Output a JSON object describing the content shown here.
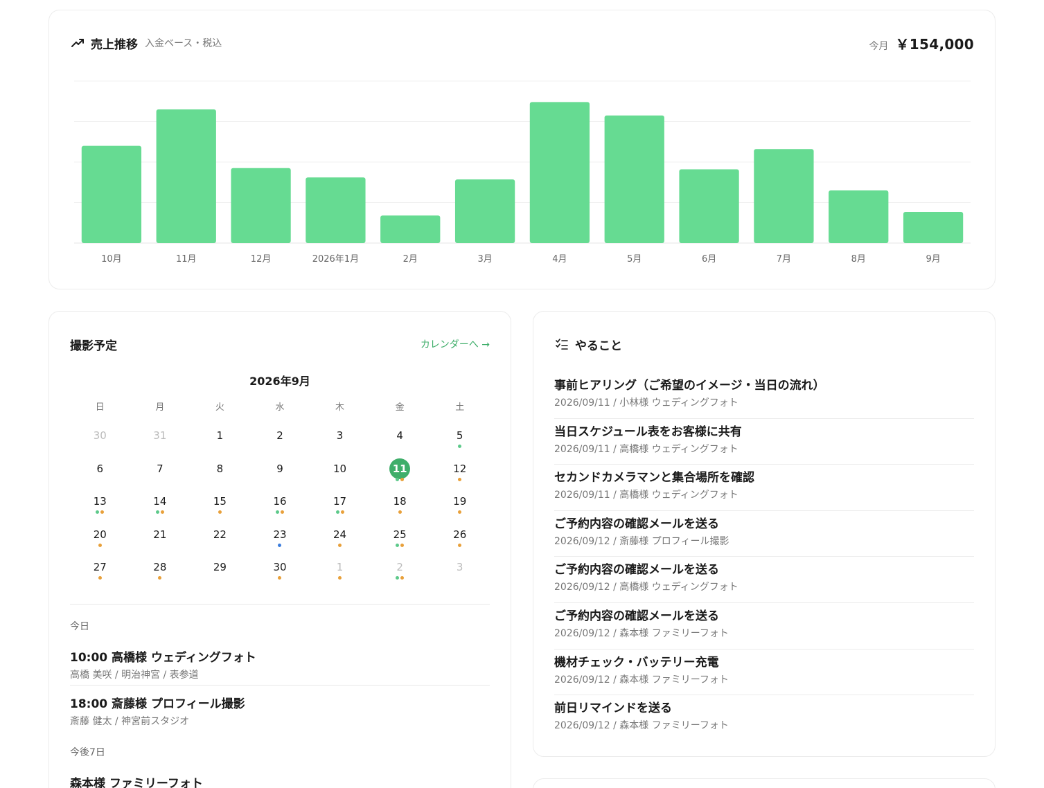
{
  "sales": {
    "title": "売上推移",
    "subtitle": "入金ベース・税込",
    "month_label": "今月",
    "month_value": "￥154,000",
    "color": "#66db92"
  },
  "chart_data": {
    "type": "bar",
    "categories": [
      "10月",
      "11月",
      "12月",
      "2026年1月",
      "2月",
      "3月",
      "4月",
      "5月",
      "6月",
      "7月",
      "8月",
      "9月"
    ],
    "values": [
      240,
      330,
      185,
      162,
      68,
      157,
      348,
      315,
      182,
      232,
      130,
      77
    ],
    "ylim": [
      0,
      400
    ],
    "grid": true,
    "title": "",
    "xlabel": "",
    "ylabel": ""
  },
  "schedule": {
    "title": "撮影予定",
    "link": "カレンダーへ →",
    "calendar_title": "2026年9月",
    "weekdays": [
      "日",
      "月",
      "火",
      "水",
      "木",
      "金",
      "土"
    ],
    "days": [
      {
        "n": "30",
        "other": true,
        "dots": []
      },
      {
        "n": "31",
        "other": true,
        "dots": []
      },
      {
        "n": "1",
        "dots": []
      },
      {
        "n": "2",
        "dots": []
      },
      {
        "n": "3",
        "dots": []
      },
      {
        "n": "4",
        "dots": []
      },
      {
        "n": "5",
        "dots": [
          "green"
        ]
      },
      {
        "n": "6",
        "dots": []
      },
      {
        "n": "7",
        "dots": []
      },
      {
        "n": "8",
        "dots": []
      },
      {
        "n": "9",
        "dots": []
      },
      {
        "n": "10",
        "dots": []
      },
      {
        "n": "11",
        "today": true,
        "dots": [
          "green",
          "orange"
        ]
      },
      {
        "n": "12",
        "dots": [
          "orange"
        ]
      },
      {
        "n": "13",
        "dots": [
          "green",
          "orange"
        ]
      },
      {
        "n": "14",
        "dots": [
          "green",
          "orange"
        ]
      },
      {
        "n": "15",
        "dots": [
          "orange"
        ]
      },
      {
        "n": "16",
        "dots": [
          "green",
          "orange"
        ]
      },
      {
        "n": "17",
        "dots": [
          "green",
          "orange"
        ]
      },
      {
        "n": "18",
        "dots": [
          "orange"
        ]
      },
      {
        "n": "19",
        "dots": [
          "orange"
        ]
      },
      {
        "n": "20",
        "dots": [
          "orange"
        ]
      },
      {
        "n": "21",
        "dots": []
      },
      {
        "n": "22",
        "dots": []
      },
      {
        "n": "23",
        "dots": [
          "blue"
        ]
      },
      {
        "n": "24",
        "dots": [
          "orange"
        ]
      },
      {
        "n": "25",
        "dots": [
          "green",
          "orange"
        ]
      },
      {
        "n": "26",
        "dots": [
          "orange"
        ]
      },
      {
        "n": "27",
        "dots": [
          "orange"
        ]
      },
      {
        "n": "28",
        "dots": [
          "orange"
        ]
      },
      {
        "n": "29",
        "dots": []
      },
      {
        "n": "30",
        "dots": [
          "orange"
        ]
      },
      {
        "n": "1",
        "other": true,
        "dots": [
          "orange"
        ]
      },
      {
        "n": "2",
        "other": true,
        "dots": [
          "green",
          "orange"
        ]
      },
      {
        "n": "3",
        "other": true,
        "dots": []
      }
    ],
    "dot_colors": {
      "green": "#5cc98a",
      "orange": "#e8a03a",
      "blue": "#3b7ddd"
    },
    "today_label": "今日",
    "today_events": [
      {
        "title": "10:00 高橋様 ウェディングフォト",
        "sub": "高橋 美咲 / 明治神宮 / 表参道"
      },
      {
        "title": "18:00 斎藤様 プロフィール撮影",
        "sub": "斎藤 健太 / 神宮前スタジオ"
      }
    ],
    "upcoming_label": "今後7日",
    "upcoming_events": [
      {
        "title": "森本様 ファミリーフォト"
      }
    ]
  },
  "todo": {
    "title": "やること",
    "items": [
      {
        "title": "事前ヒアリング（ご希望のイメージ・当日の流れ）",
        "sub": "2026/09/11 / 小林様 ウェディングフォト"
      },
      {
        "title": "当日スケジュール表をお客様に共有",
        "sub": "2026/09/11 / 高橋様 ウェディングフォト"
      },
      {
        "title": "セカンドカメラマンと集合場所を確認",
        "sub": "2026/09/11 / 高橋様 ウェディングフォト"
      },
      {
        "title": "ご予約内容の確認メールを送る",
        "sub": "2026/09/12 / 斎藤様 プロフィール撮影"
      },
      {
        "title": "ご予約内容の確認メールを送る",
        "sub": "2026/09/12 / 高橋様 ウェディングフォト"
      },
      {
        "title": "ご予約内容の確認メールを送る",
        "sub": "2026/09/12 / 森本様 ファミリーフォト"
      },
      {
        "title": "機材チェック・バッテリー充電",
        "sub": "2026/09/12 / 森本様 ファミリーフォト"
      },
      {
        "title": "前日リマインドを送る",
        "sub": "2026/09/12 / 森本様 ファミリーフォト"
      }
    ]
  }
}
